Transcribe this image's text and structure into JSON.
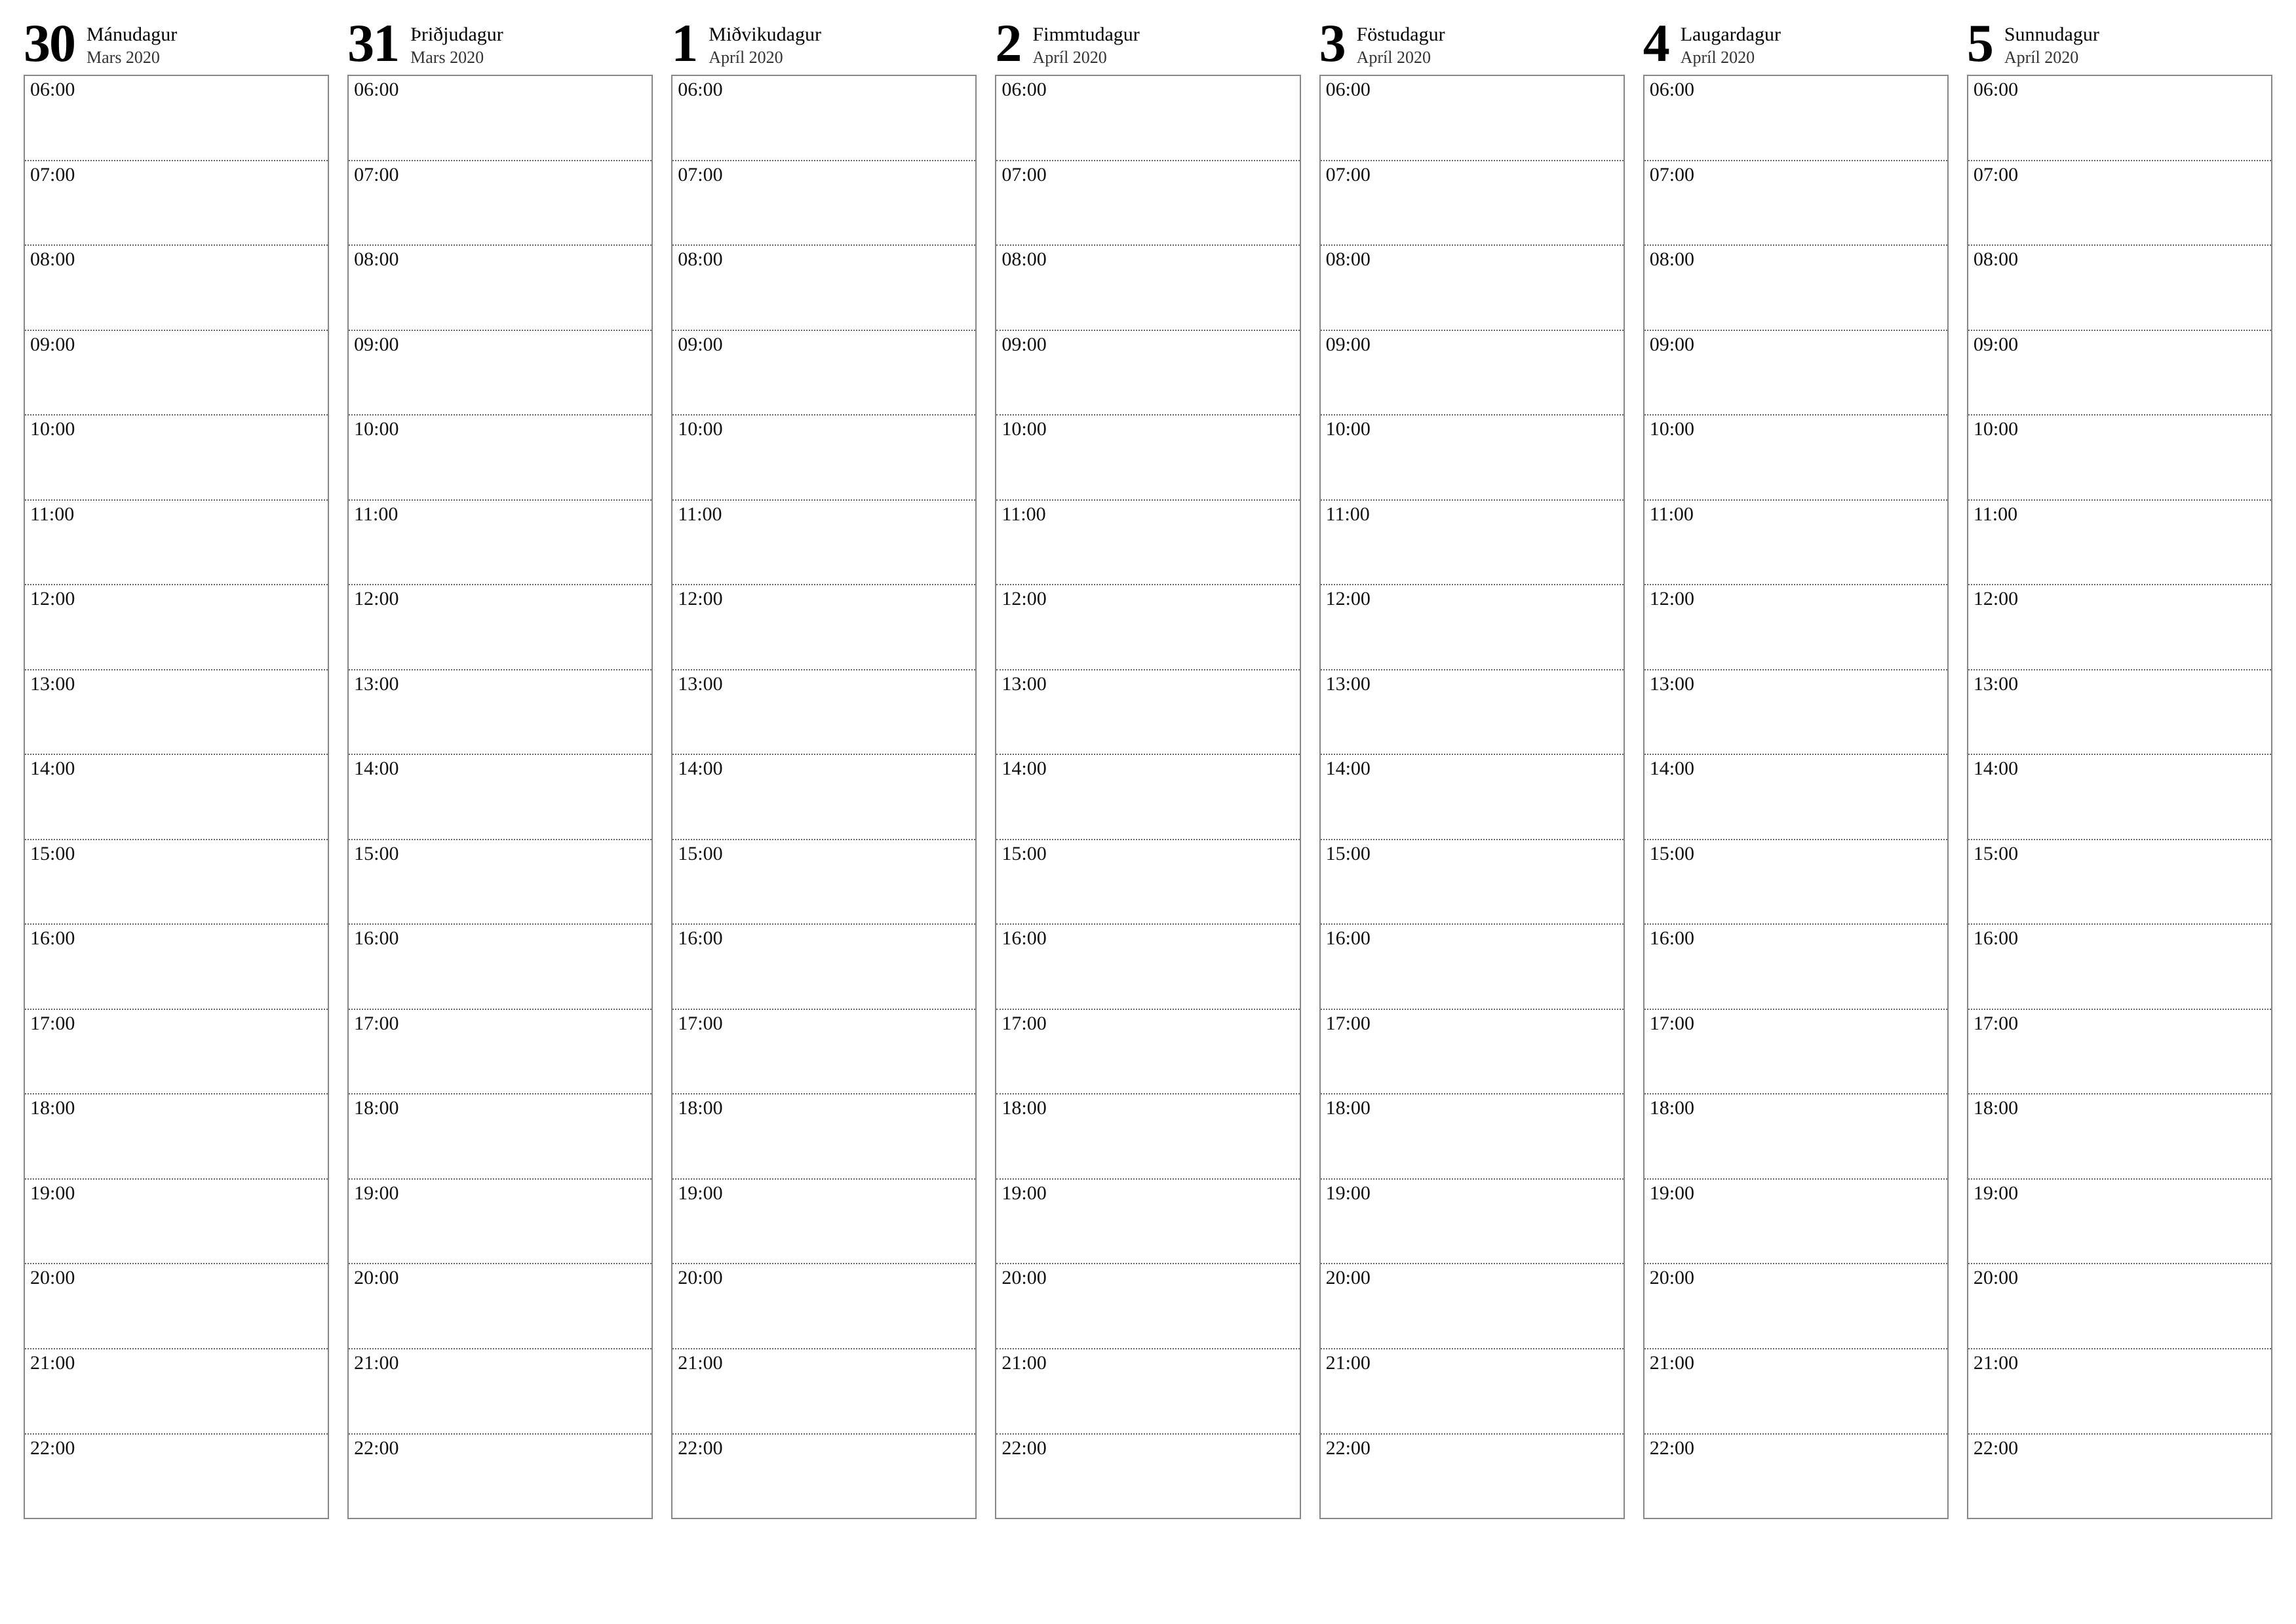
{
  "hours": [
    "06:00",
    "07:00",
    "08:00",
    "09:00",
    "10:00",
    "11:00",
    "12:00",
    "13:00",
    "14:00",
    "15:00",
    "16:00",
    "17:00",
    "18:00",
    "19:00",
    "20:00",
    "21:00",
    "22:00"
  ],
  "days": [
    {
      "number": "30",
      "name": "Mánudagur",
      "sub": "Mars 2020"
    },
    {
      "number": "31",
      "name": "Þriðjudagur",
      "sub": "Mars 2020"
    },
    {
      "number": "1",
      "name": "Miðvikudagur",
      "sub": "Apríl 2020"
    },
    {
      "number": "2",
      "name": "Fimmtudagur",
      "sub": "Apríl 2020"
    },
    {
      "number": "3",
      "name": "Föstudagur",
      "sub": "Apríl 2020"
    },
    {
      "number": "4",
      "name": "Laugardagur",
      "sub": "Apríl 2020"
    },
    {
      "number": "5",
      "name": "Sunnudagur",
      "sub": "Apríl 2020"
    }
  ]
}
